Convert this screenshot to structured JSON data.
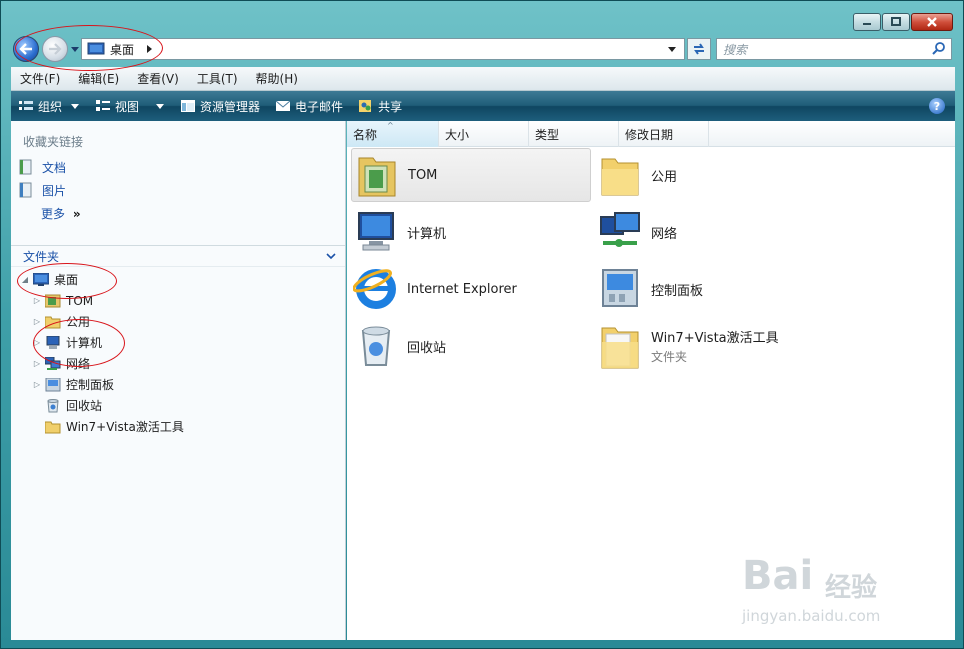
{
  "window": {
    "min_icon": "minimize-icon",
    "max_icon": "maximize-icon",
    "close_icon": "close-icon"
  },
  "address": {
    "location": "桌面",
    "search_placeholder": "搜索"
  },
  "menu": [
    "文件(F)",
    "编辑(E)",
    "查看(V)",
    "工具(T)",
    "帮助(H)"
  ],
  "toolbar": {
    "organize": "组织",
    "view": "视图",
    "explorer": "资源管理器",
    "email": "电子邮件",
    "share": "共享",
    "help": "?"
  },
  "sidebar": {
    "favorites_title": "收藏夹链接",
    "favorites": [
      "文档",
      "图片"
    ],
    "more": "更多",
    "folders_title": "文件夹",
    "tree": [
      {
        "label": "桌面",
        "expanded": true
      },
      {
        "label": "TOM"
      },
      {
        "label": "公用"
      },
      {
        "label": "计算机"
      },
      {
        "label": "网络"
      },
      {
        "label": "控制面板"
      },
      {
        "label": "回收站"
      },
      {
        "label": "Win7+Vista激活工具"
      }
    ]
  },
  "columns": [
    "名称",
    "大小",
    "类型",
    "修改日期"
  ],
  "items": [
    {
      "label": "TOM",
      "sub": ""
    },
    {
      "label": "公用",
      "sub": ""
    },
    {
      "label": "计算机",
      "sub": ""
    },
    {
      "label": "网络",
      "sub": ""
    },
    {
      "label": "Internet Explorer",
      "sub": ""
    },
    {
      "label": "控制面板",
      "sub": ""
    },
    {
      "label": "回收站",
      "sub": ""
    },
    {
      "label": "Win7+Vista激活工具",
      "sub": "文件夹"
    }
  ],
  "watermark": {
    "brand": "Bai",
    "brand2": "经验",
    "url": "jingyan.baidu.com"
  }
}
